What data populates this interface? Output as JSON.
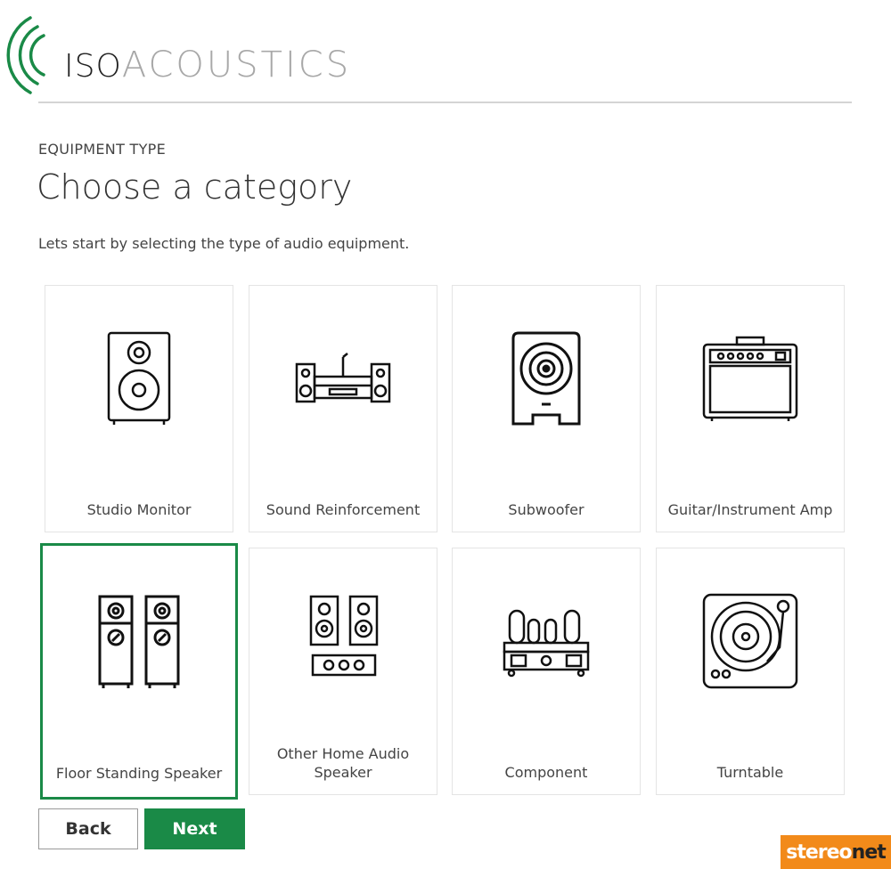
{
  "brand": {
    "logo_part1": "ISO",
    "logo_part2": "ACOUSTICS",
    "accent_color": "#1a8a47"
  },
  "header": {
    "eyebrow": "EQUIPMENT TYPE",
    "title": "Choose a category",
    "subtitle": "Lets start by selecting the type of audio equipment."
  },
  "categories": [
    {
      "label": "Studio Monitor",
      "icon": "studio-monitor-icon",
      "selected": false
    },
    {
      "label": "Sound Reinforcement",
      "icon": "sound-reinforcement-icon",
      "selected": false
    },
    {
      "label": "Subwoofer",
      "icon": "subwoofer-icon",
      "selected": false
    },
    {
      "label": "Guitar/Instrument Amp",
      "icon": "guitar-amp-icon",
      "selected": false
    },
    {
      "label": "Floor Standing Speaker",
      "icon": "floor-standing-speaker-icon",
      "selected": true
    },
    {
      "label": "Other Home Audio Speaker",
      "icon": "home-audio-speaker-icon",
      "selected": false
    },
    {
      "label": "Component",
      "icon": "component-icon",
      "selected": false
    },
    {
      "label": "Turntable",
      "icon": "turntable-icon",
      "selected": false
    }
  ],
  "actions": {
    "back_label": "Back",
    "next_label": "Next"
  },
  "watermark": {
    "text_part1": "stereo",
    "text_part2": "net"
  }
}
